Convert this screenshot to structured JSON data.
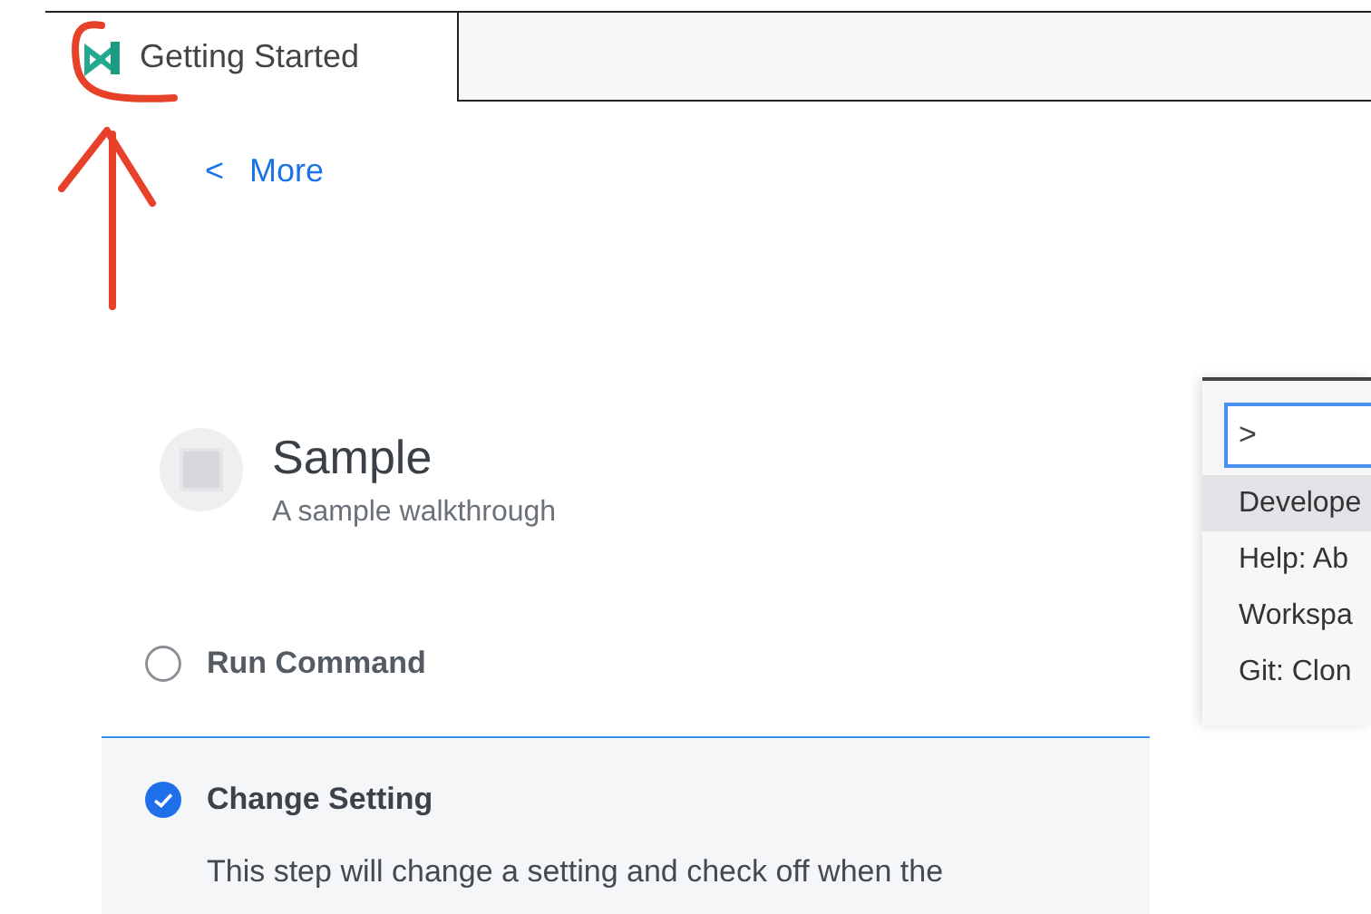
{
  "tabs": [
    {
      "label": "Getting Started",
      "selected": true
    }
  ],
  "back_link": {
    "icon": "<",
    "label": "More"
  },
  "walkthrough": {
    "title": "Sample",
    "description": "A sample walkthrough"
  },
  "steps": [
    {
      "title": "Run Command",
      "checked": false,
      "expanded": false
    },
    {
      "title": "Change Setting",
      "checked": true,
      "expanded": true,
      "description": "This step will change a setting and check off when the"
    }
  ],
  "command_palette": {
    "value": ">",
    "items": [
      {
        "label": "Develope",
        "selected": true
      },
      {
        "label": "Help: Ab",
        "selected": false
      },
      {
        "label": "Workspa",
        "selected": false
      },
      {
        "label": "Git: Clon",
        "selected": false
      }
    ]
  }
}
